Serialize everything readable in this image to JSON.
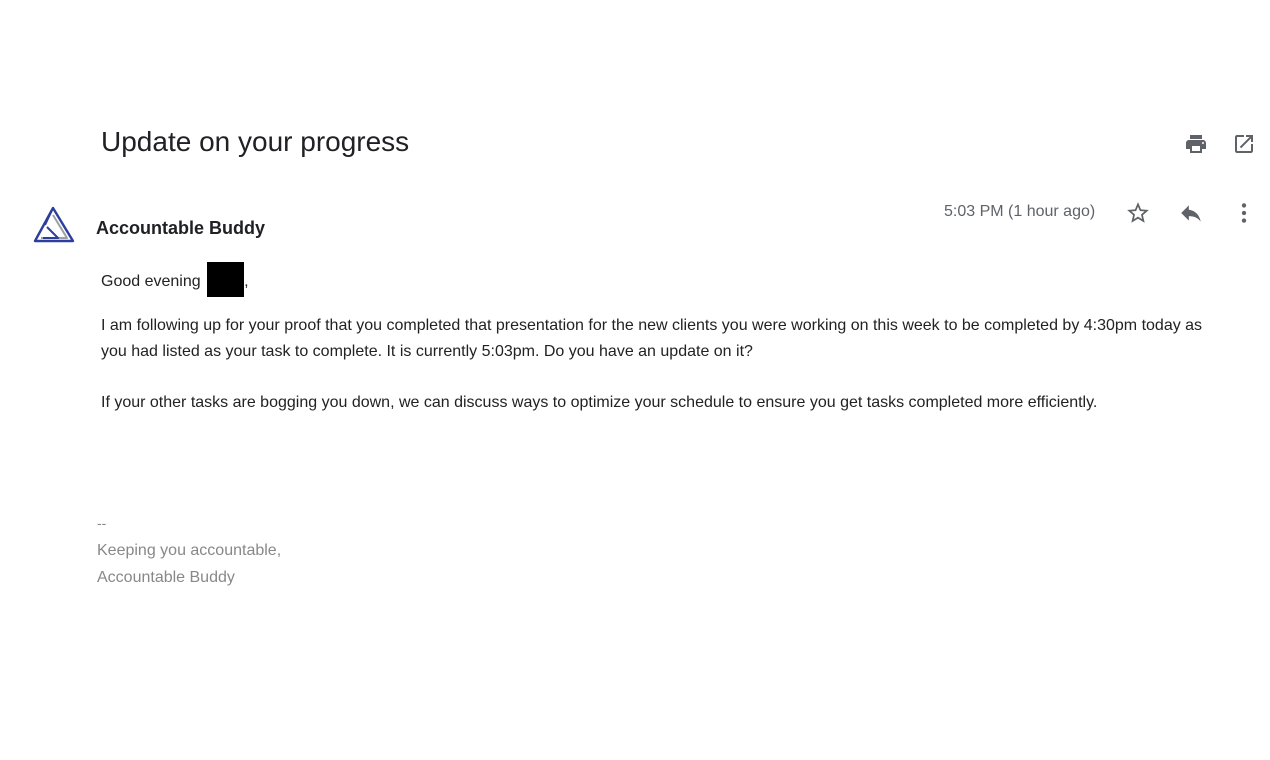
{
  "email": {
    "subject": "Update on your progress",
    "sender_name": "Accountable Buddy",
    "timestamp": "5:03 PM (1 hour ago)",
    "greeting_prefix": "Good evening",
    "greeting_suffix": ",",
    "paragraphs": [
      "I am following up for your proof that you completed that presentation for the new  clients you were working on this week to be completed by 4:30pm today as you had listed as your task to complete. It is currently 5:03pm. Do you have an update on it?",
      "If your other tasks are bogging you down, we can discuss ways to optimize your schedule to ensure you get tasks completed more efficiently."
    ],
    "signature": {
      "separator": "--",
      "line1": "Keeping you accountable,",
      "line2": "Accountable Buddy"
    }
  },
  "icons": {
    "print": "print-icon",
    "open_in_new_window": "open-in-new-window-icon",
    "avatar_logo": "accountable-buddy-logo",
    "star": "star-icon",
    "reply": "reply-icon",
    "more": "more-vertical-icon"
  },
  "colors": {
    "subject_text": "#202124",
    "meta_text": "#5f6368",
    "body_text": "#222222",
    "signature_text": "#888888",
    "logo_blue": "#2d3e9c",
    "logo_gray": "#9aa0a6"
  }
}
